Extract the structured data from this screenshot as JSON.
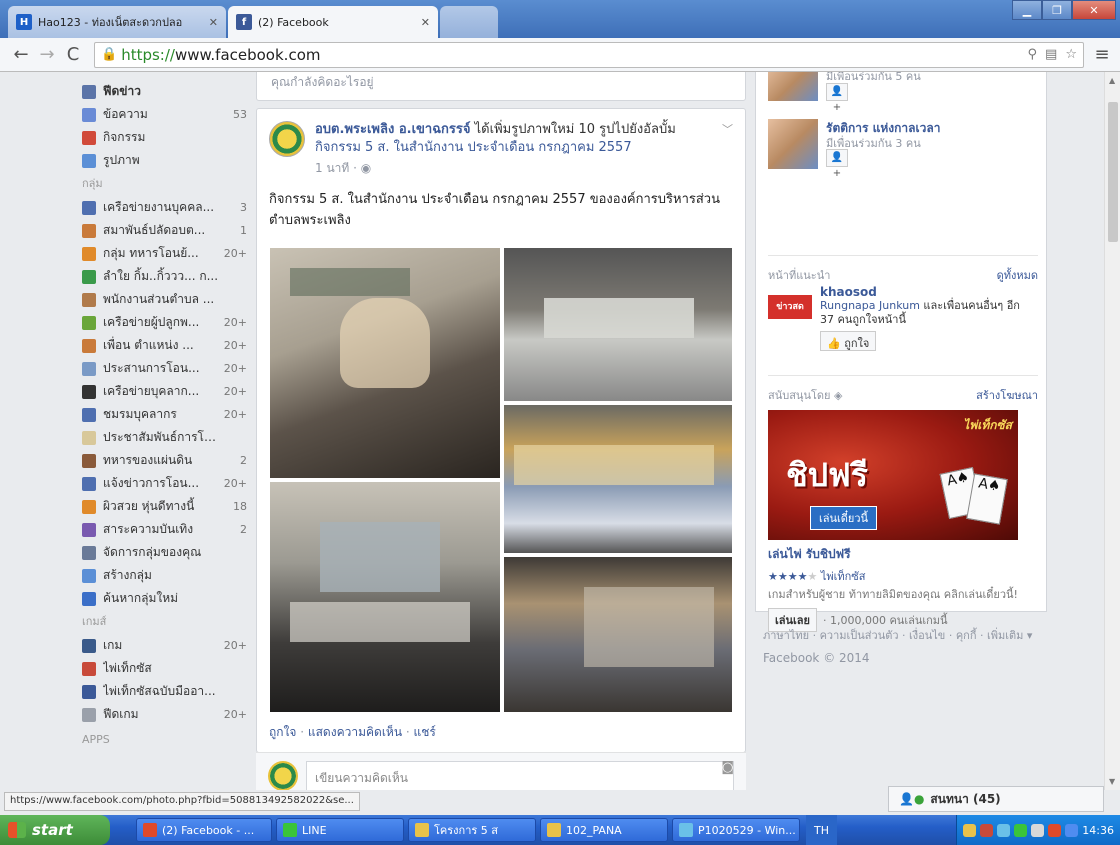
{
  "browser": {
    "tabs": [
      {
        "title": "Hao123 - ท่องเน็ตสะดวกปลอ",
        "favicon": "hao123-icon"
      },
      {
        "title": "(2) Facebook",
        "favicon": "facebook-icon"
      }
    ],
    "url_scheme": "https://",
    "url_host": "www.facebook.com",
    "status_url": "https://www.facebook.com/photo.php?fbid=508813492582022&se..."
  },
  "sidebar": {
    "favorites": [
      {
        "label": "ฟีดข่าว",
        "count": "",
        "icon": "news-feed-icon",
        "color": "#5b74a8",
        "bold": true
      },
      {
        "label": "ข้อความ",
        "count": "53",
        "icon": "messages-icon",
        "color": "#6a8bd6"
      },
      {
        "label": "กิจกรรม",
        "count": "",
        "icon": "calendar-icon",
        "color": "#d14a3a"
      },
      {
        "label": "รูปภาพ",
        "count": "",
        "icon": "photos-icon",
        "color": "#5b8fd6"
      }
    ],
    "groups_heading": "กลุ่ม",
    "groups": [
      {
        "label": "เครือข่ายงานบุคคล...",
        "count": "3",
        "icon": "group-icon",
        "color": "#4f6fb0"
      },
      {
        "label": "สมาพันธ์ปลัดอบต...",
        "count": "1",
        "icon": "group-icon",
        "color": "#c97a3a"
      },
      {
        "label": "กลุ่ม ทหารโอนย้...",
        "count": "20+",
        "icon": "group-icon",
        "color": "#e08a2a"
      },
      {
        "label": "ลำใย กิ้ม..กิ้ววว... ก...",
        "count": "",
        "icon": "group-icon",
        "color": "#3a9a4a"
      },
      {
        "label": "พนักงานส่วนตำบล ...",
        "count": "",
        "icon": "group-icon",
        "color": "#b07a4a"
      },
      {
        "label": "เครือข่ายผู้ปลูกพ...",
        "count": "20+",
        "icon": "group-icon",
        "color": "#6aa63a"
      },
      {
        "label": "เพื่อน ตำแหน่ง ...",
        "count": "20+",
        "icon": "group-icon",
        "color": "#c97a3a"
      },
      {
        "label": "ประสานการโอน...",
        "count": "20+",
        "icon": "group-icon",
        "color": "#7a9ac6"
      },
      {
        "label": "เครือข่ายบุคลาก...",
        "count": "20+",
        "icon": "group-icon",
        "color": "#333333"
      },
      {
        "label": "ชมรมบุคลากร",
        "count": "20+",
        "icon": "group-icon",
        "color": "#4f6fb0"
      },
      {
        "label": "ประชาสัมพันธ์การโอ...",
        "count": "",
        "icon": "group-icon",
        "color": "#d8c89a"
      },
      {
        "label": "ทหารของแผ่นดิน",
        "count": "2",
        "icon": "group-icon",
        "color": "#8a5a3a"
      },
      {
        "label": "แจ้งข่าวการโอน...",
        "count": "20+",
        "icon": "group-icon",
        "color": "#4f6fb0"
      },
      {
        "label": "ผิวสวย หุ่นดีทางนี้",
        "count": "18",
        "icon": "group-icon",
        "color": "#e08a2a"
      },
      {
        "label": "สาระความบันเทิง",
        "count": "2",
        "icon": "group-icon",
        "color": "#7a5ab0"
      },
      {
        "label": "จัดการกลุ่มของคุณ",
        "count": "",
        "icon": "manage-groups-icon",
        "color": "#6a7a98"
      },
      {
        "label": "สร้างกลุ่ม",
        "count": "",
        "icon": "create-group-icon",
        "color": "#5b8fd6"
      },
      {
        "label": "ค้นหากลุ่มใหม่",
        "count": "",
        "icon": "find-groups-icon",
        "color": "#3b6fc8"
      }
    ],
    "games_heading": "เกมส์",
    "games": [
      {
        "label": "เกม",
        "count": "20+",
        "icon": "games-icon",
        "color": "#3a5a8a"
      },
      {
        "label": "ไพ่เท็กซัส",
        "count": "",
        "icon": "texas-poker-icon",
        "color": "#c84a3a"
      },
      {
        "label": "ไพ่เท็กซัสฉบับมืออา...",
        "count": "",
        "icon": "poker-pro-icon",
        "color": "#3b5998"
      },
      {
        "label": "ฟีดเกม",
        "count": "20+",
        "icon": "game-feed-icon",
        "color": "#9aa0aa"
      }
    ],
    "apps_heading": "APPS"
  },
  "feed": {
    "composer_hint": "คุณกำลังคิดอะไรอยู่",
    "post": {
      "author": "อบต.พระเพลิง อ.เขาฉกรรจ์",
      "action": " ได้เพิ่มรูปภาพใหม่ 10 รูปไปยังอัลบั้ม ",
      "album": "กิจกรรม 5 ส. ในสำนักงาน ประจำเดือน กรกฎาคม 2557",
      "time": "1 นาที · ◉",
      "text": "กิจกรรม 5 ส. ในสำนักงาน ประจำเดือน กรกฎาคม 2557 ขององค์การบริหารส่วนตำบลพระเพลิง",
      "like": "ถูกใจ",
      "comment": "แสดงความคิดเห็น",
      "share": "แชร์",
      "comment_placeholder": "เขียนความคิดเห็น"
    }
  },
  "right": {
    "friends": [
      {
        "name": "",
        "mutual": "มีเพื่อนร่วมกัน 5 คน"
      },
      {
        "name": "รัตติการ แห่งกาลเวลา",
        "mutual": "มีเพื่อนร่วมกัน 3 คน"
      }
    ],
    "pages_heading": "หน้าที่แนะนำ",
    "pages_see_all": "ดูทั้งหมด",
    "page": {
      "logo": "ข่าวสด",
      "name": "khaosod",
      "text_a": "Rungnapa Junkum",
      "text_b": " และเพื่อนคนอื่นๆ อีก 37 คนถูกใจหน้านี้",
      "like_btn": "ถูกใจ"
    },
    "sponsored_heading": "สนับสนุนโดย ◈",
    "create_ad": "สร้างโฆษณา",
    "ad": {
      "brand": "ไพ่เท็กซัส",
      "big_text": "ชิปฟรี",
      "cta": "เล่นเดี๋ยวนี้",
      "title": "เล่นไพ่ รับชิปฟรี",
      "stars": "★★★★",
      "star_off": "★",
      "app_name": "ไพ่เท็กซัส",
      "desc": "เกมสำหรับผู้ชาย ท้าทายลิมิตของคุณ คลิกเล่นเดี๋ยวนี้!",
      "play_btn": "เล่นเลย",
      "players": "· 1,000,000 คนเล่นเกมนี้"
    },
    "footer_links": "ภาษาไทย · ความเป็นส่วนตัว · เงื่อนไข · คุกกี้ · เพิ่มเติม ▾",
    "copyright": "Facebook © 2014"
  },
  "chat": {
    "label": "สนทนา (45)"
  },
  "taskbar": {
    "start": "start",
    "items": [
      {
        "label": "(2) Facebook - ...",
        "icon": "chrome-icon",
        "color": "#e04a2a"
      },
      {
        "label": "LINE",
        "icon": "line-icon",
        "color": "#3ac43a"
      },
      {
        "label": "โครงการ 5 ส",
        "icon": "folder-icon",
        "color": "#e8c24a"
      },
      {
        "label": "102_PANA",
        "icon": "folder-icon",
        "color": "#e8c24a"
      },
      {
        "label": "P1020529 - Win...",
        "icon": "image-viewer-icon",
        "color": "#6ac0e8"
      }
    ],
    "lang": "TH",
    "clock": "14:36"
  }
}
